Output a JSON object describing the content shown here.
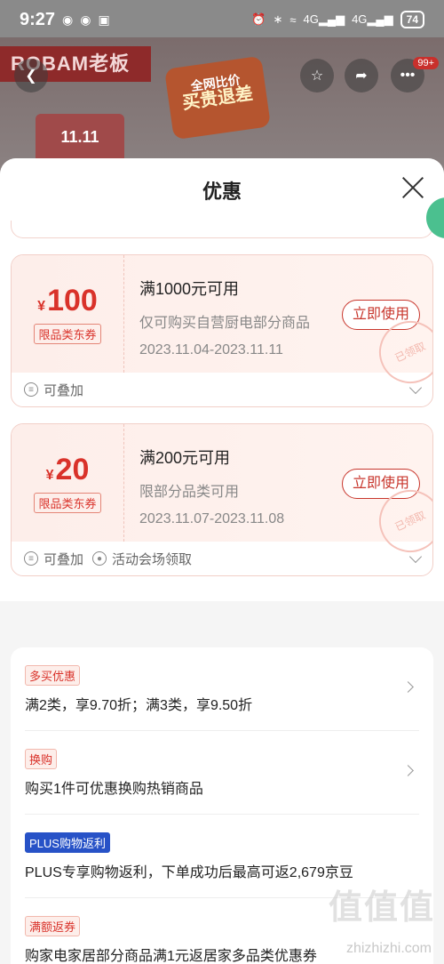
{
  "status": {
    "time": "9:27",
    "battery": "74"
  },
  "background": {
    "brand": "ROBAM老板",
    "promo_line1": "全网比价",
    "promo_line2": "买贵退差",
    "event": "11.11",
    "badge": "99+"
  },
  "sheet": {
    "title": "优惠"
  },
  "coupons": [
    {
      "yen": "¥",
      "amount": "100",
      "type": "限品类东券",
      "condition": "满1000元可用",
      "scope": "仅可购买自营厨电部分商品",
      "dates": "2023.11.04-2023.11.11",
      "button": "立即使用",
      "stamp": "已领取",
      "stackable": "可叠加",
      "source": ""
    },
    {
      "yen": "¥",
      "amount": "20",
      "type": "限品类东券",
      "condition": "满200元可用",
      "scope": "限部分品类可用",
      "dates": "2023.11.07-2023.11.08",
      "button": "立即使用",
      "stamp": "已领取",
      "stackable": "可叠加",
      "source": "活动会场领取"
    }
  ],
  "promos": [
    {
      "tag": "多买优惠",
      "text": "满2类，享9.70折；满3类，享9.50折"
    },
    {
      "tag": "换购",
      "text": "购买1件可优惠换购热销商品"
    },
    {
      "tag": "PLUS购物返利",
      "text": "PLUS专享购物返利，下单成功后最高可返2,679京豆"
    },
    {
      "tag": "满额返券",
      "text": "购家电家居部分商品满1元返居家多品类优惠券"
    }
  ],
  "watermark": {
    "logo": "值值值",
    "url": "zhizhizhi.com"
  }
}
